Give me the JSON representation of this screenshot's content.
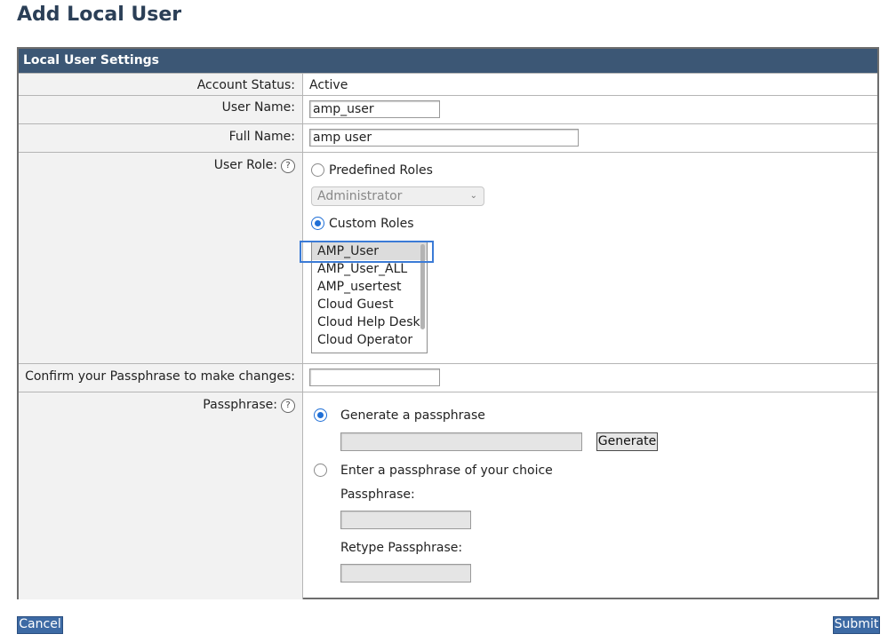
{
  "page_title": "Add Local User",
  "panel": {
    "header": "Local User Settings"
  },
  "account_status": {
    "label": "Account Status:",
    "value": "Active"
  },
  "user_name": {
    "label": "User Name:",
    "value": "amp_user"
  },
  "full_name": {
    "label": "Full Name:",
    "value": "amp user"
  },
  "user_role": {
    "label": "User Role:",
    "help_icon": "help-icon",
    "predefined_label": "Predefined Roles",
    "predefined_checked": false,
    "predefined_select_value": "Administrator",
    "custom_label": "Custom Roles",
    "custom_checked": true,
    "custom_roles": [
      "AMP_User",
      "AMP_User_ALL",
      "AMP_usertest",
      "Cloud Guest",
      "Cloud Help Desk",
      "Cloud Operator"
    ],
    "selected_role": "AMP_User"
  },
  "confirm": {
    "label": "Confirm your Passphrase to make changes:",
    "value": ""
  },
  "passphrase": {
    "label": "Passphrase:",
    "generate_label": "Generate a passphrase",
    "generate_checked": true,
    "generate_button": "Generate",
    "choice_label": "Enter a passphrase of your choice",
    "choice_checked": false,
    "pass_label": "Passphrase:",
    "retype_label": "Retype Passphrase:"
  },
  "footer": {
    "cancel": "Cancel",
    "submit": "Submit"
  },
  "colors": {
    "header_bg": "#3c5775",
    "title": "#2b3f57",
    "accent": "#1f6fd6",
    "button_blue": "#3d6aa4"
  }
}
